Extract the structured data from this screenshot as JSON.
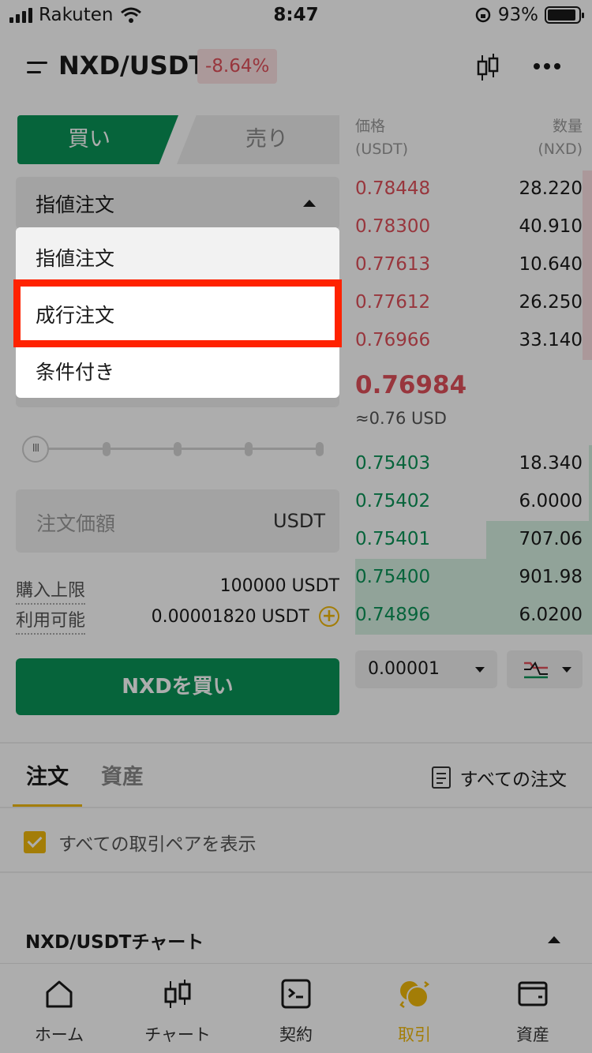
{
  "status_bar": {
    "carrier": "Rakuten",
    "time": "8:47",
    "battery": "93%"
  },
  "header": {
    "pair": "NXD/USDT",
    "change": "-8.64%"
  },
  "trade": {
    "buy_tab": "買い",
    "sell_tab": "売り",
    "order_type_selected": "指値注文",
    "amount_placeholder": "注文価額",
    "amount_unit": "USDT",
    "limit_label": "購入上限",
    "limit_value": "100000 USDT",
    "available_label": "利用可能",
    "available_value": "0.00001820 USDT",
    "buy_button": "NXDを買い"
  },
  "order_type_menu": {
    "options": [
      "指値注文",
      "成行注文",
      "条件付き"
    ],
    "selected_index": 0,
    "highlighted_index": 1
  },
  "order_book": {
    "price_header": "価格",
    "price_unit": "(USDT)",
    "qty_header": "数量",
    "qty_unit": "(NXD)",
    "asks": [
      {
        "price": "0.78448",
        "qty": "28.220"
      },
      {
        "price": "0.78300",
        "qty": "40.910"
      },
      {
        "price": "0.77613",
        "qty": "10.640"
      },
      {
        "price": "0.77612",
        "qty": "26.250"
      },
      {
        "price": "0.76966",
        "qty": "33.140"
      }
    ],
    "last_price": "0.76984",
    "last_price_usd": "≈0.76 USD",
    "bids": [
      {
        "price": "0.75403",
        "qty": "18.340"
      },
      {
        "price": "0.75402",
        "qty": "6.0000"
      },
      {
        "price": "0.75401",
        "qty": "707.06"
      },
      {
        "price": "0.75400",
        "qty": "901.98"
      },
      {
        "price": "0.74896",
        "qty": "6.0200"
      }
    ],
    "precision": "0.00001"
  },
  "orders_section": {
    "tab_orders": "注文",
    "tab_assets": "資産",
    "all_orders": "すべての注文",
    "show_all_pairs": "すべての取引ペアを表示",
    "chart_section": "NXD/USDTチャート"
  },
  "bottom_nav": [
    {
      "label": "ホーム",
      "icon": "home-icon"
    },
    {
      "label": "チャート",
      "icon": "candlestick-icon"
    },
    {
      "label": "契約",
      "icon": "contract-icon"
    },
    {
      "label": "取引",
      "icon": "trade-icon"
    },
    {
      "label": "資産",
      "icon": "wallet-icon"
    }
  ],
  "colors": {
    "buy_green": "#0a9457",
    "sell_red": "#e0505a",
    "accent": "#f0b90b",
    "highlight_box": "#ff2200"
  }
}
